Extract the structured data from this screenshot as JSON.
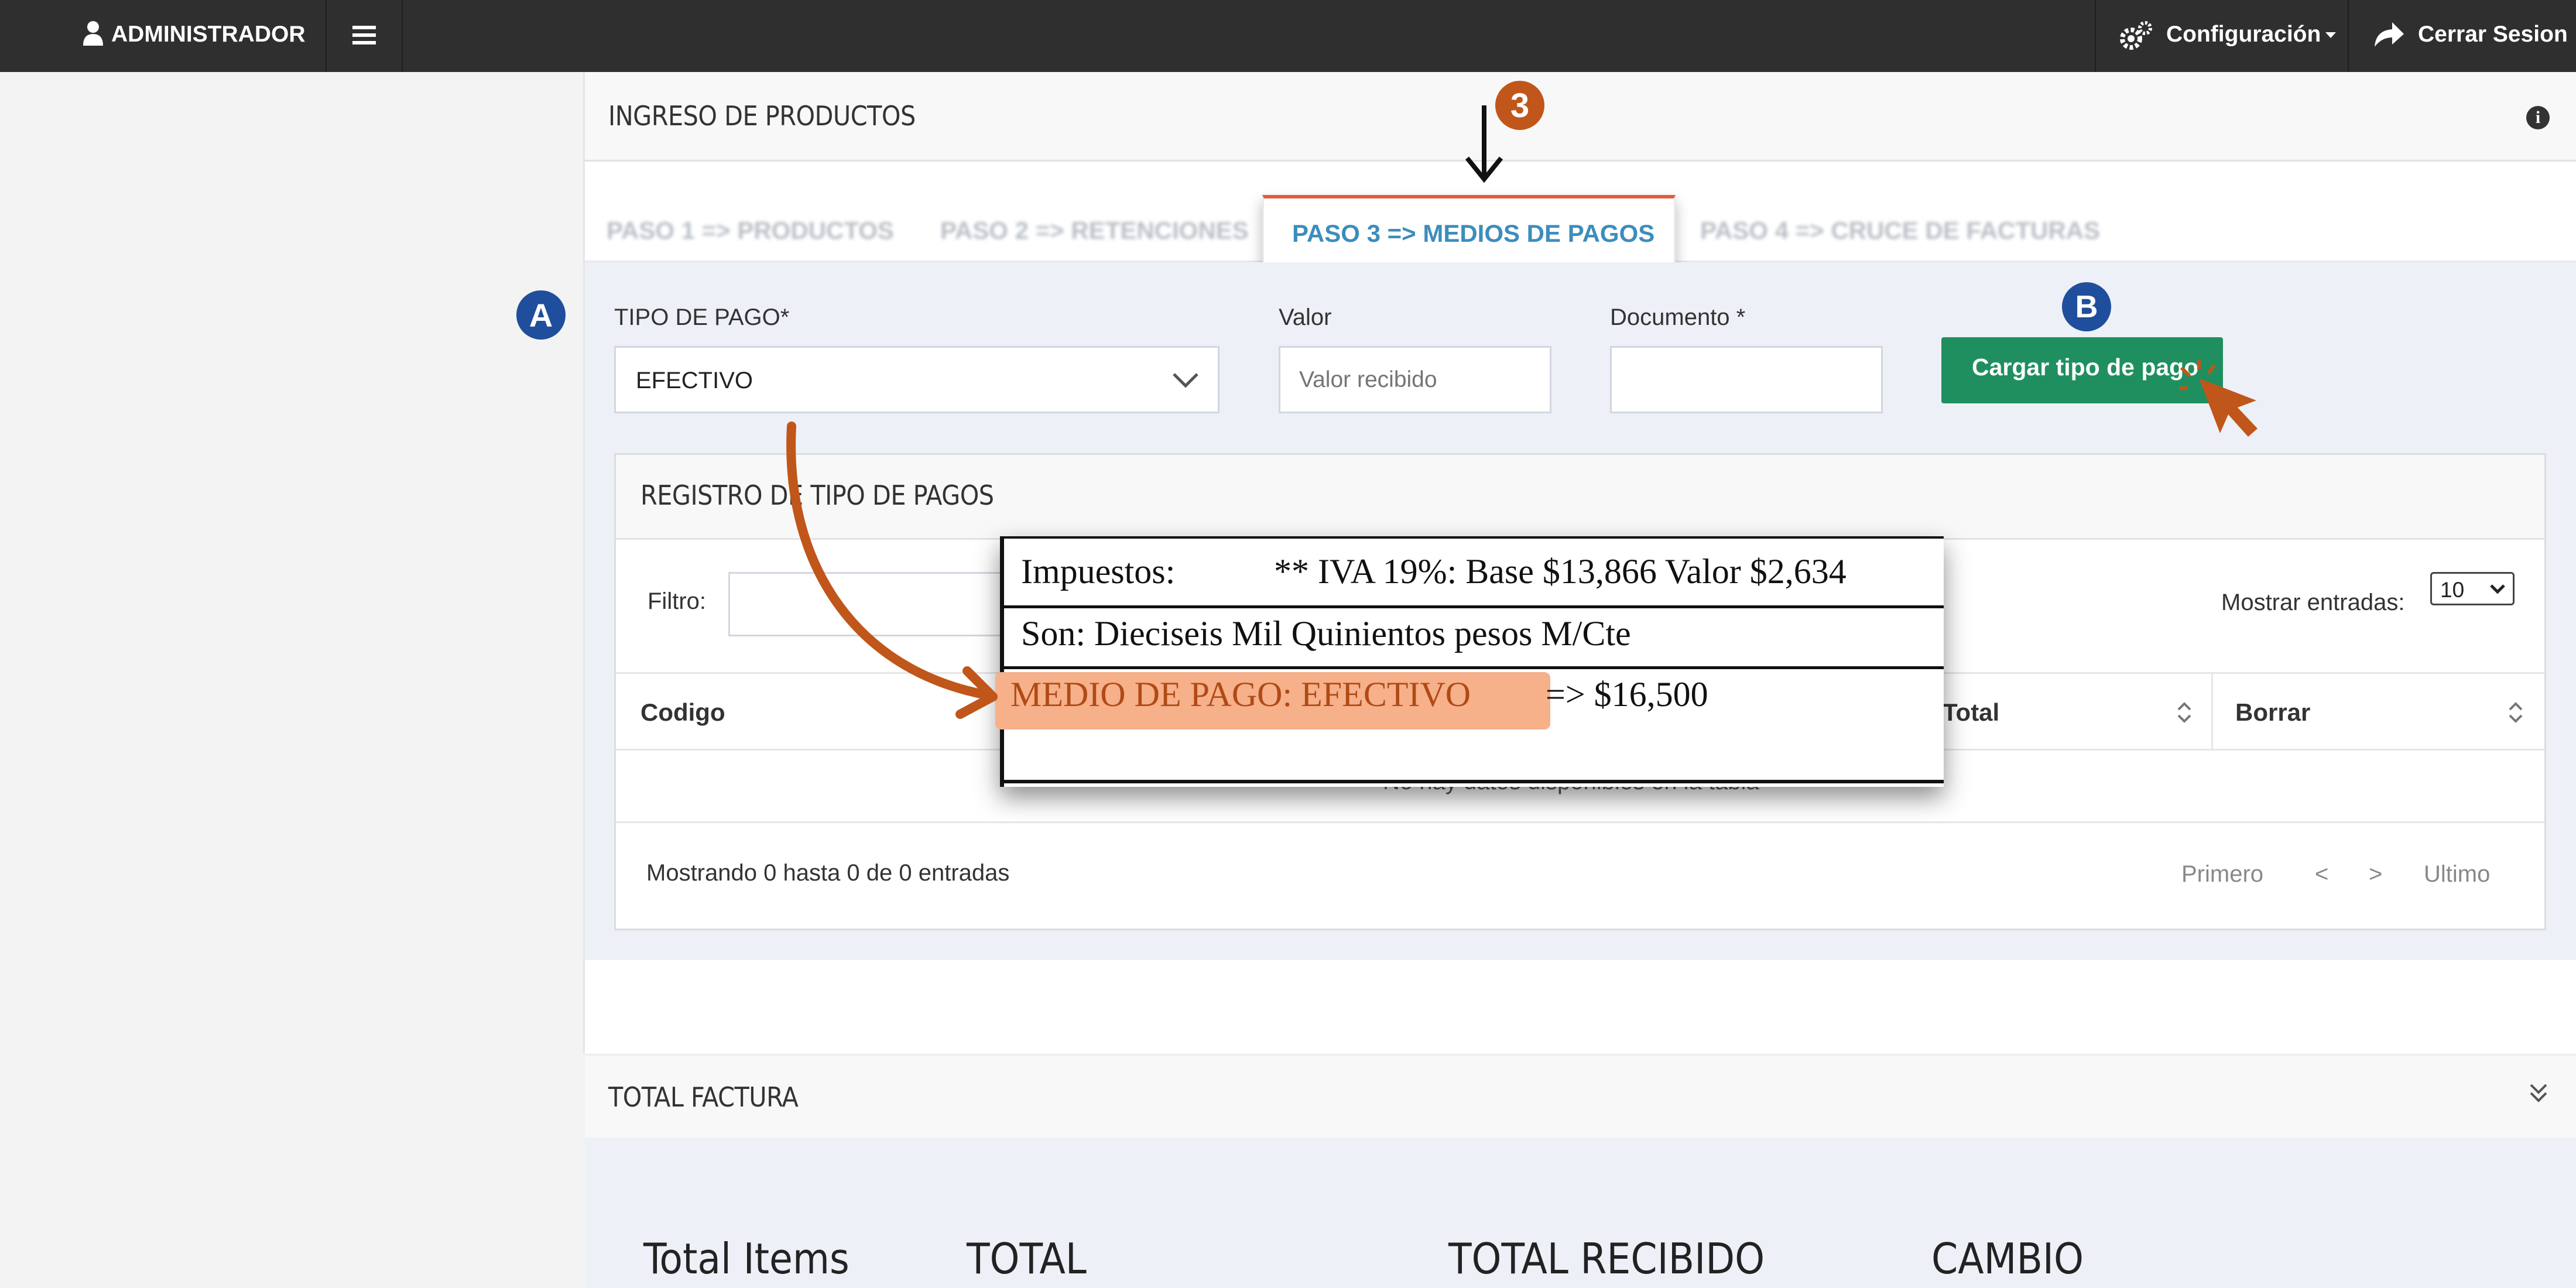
{
  "topbar": {
    "user_label": "ADMINISTRADOR",
    "config_label": "Configuración",
    "logout_label": "Cerrar Sesion"
  },
  "panel": {
    "title": "INGRESO DE PRODUCTOS",
    "tabs": [
      {
        "label": "PASO 1 => PRODUCTOS"
      },
      {
        "label": "PASO 2 => RETENCIONES"
      },
      {
        "label": "PASO 3 => MEDIOS DE PAGOS"
      },
      {
        "label": "PASO 4 => CRUCE DE FACTURAS"
      }
    ],
    "active_tab": 2
  },
  "form": {
    "tipo_pago_label": "TIPO DE PAGO*",
    "tipo_pago_value": "EFECTIVO",
    "valor_label": "Valor",
    "valor_placeholder": "Valor recibido",
    "documento_label": "Documento *",
    "documento_value": "",
    "submit_label": "Cargar tipo de pago"
  },
  "registro": {
    "title": "REGISTRO DE TIPO DE PAGOS",
    "filter_label": "Filtro:",
    "show_label": "Mostrar entradas:",
    "show_value": "10",
    "columns": [
      "Codigo",
      "Total",
      "Borrar"
    ],
    "empty_text": "No hay datos disponibles en la tabla",
    "info": "Mostrando 0 hasta 0 de 0 entradas",
    "pager": {
      "first": "Primero",
      "prev": "<",
      "next": ">",
      "last": "Ultimo"
    }
  },
  "invoice_excerpt": {
    "taxes_label": "Impuestos:",
    "taxes_value": "** IVA 19%: Base $13,866 Valor $2,634",
    "son": "Son:  Dieciseis Mil Quinientos pesos M/Cte",
    "payment_highlight": "MEDIO DE PAGO:   EFECTIVO",
    "payment_amount": "=> $16,500"
  },
  "total_factura": {
    "title": "TOTAL FACTURA",
    "labels": [
      "Total Items",
      "TOTAL",
      "TOTAL RECIBIDO",
      "CAMBIO"
    ]
  },
  "annotations": {
    "step": "3",
    "marker_a": "A",
    "marker_b": "B"
  },
  "colors": {
    "topbar": "#2f2f2f",
    "primary_green": "#1f8f5f",
    "link_blue": "#3c8dbc",
    "annotation_orange": "#c0561a",
    "annotation_navy": "#1f4e9c",
    "highlight": "#f6b08a"
  }
}
